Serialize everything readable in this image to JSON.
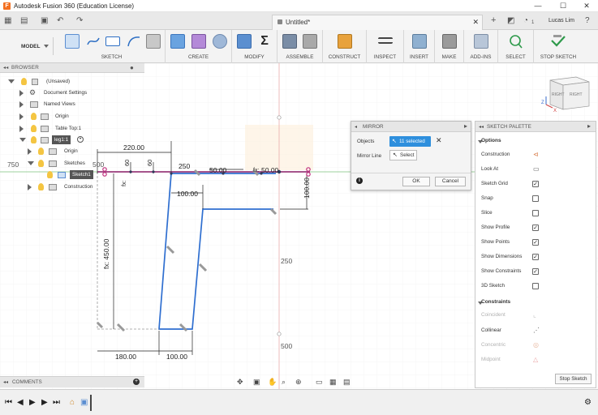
{
  "window": {
    "app_icon_letter": "F",
    "title": "Autodesk Fusion 360 (Education License)",
    "minimize": "—",
    "maximize": "☐",
    "close": "✕"
  },
  "tabbar": {
    "document_name": "Untitled*",
    "close_tab": "✕",
    "new_tab": "+",
    "user_name": "Lucas Lim",
    "notification_count": "1"
  },
  "ribbon": {
    "workspace": "MODEL",
    "groups": [
      "SKETCH",
      "CREATE",
      "MODIFY",
      "ASSEMBLE",
      "CONSTRUCT",
      "INSPECT",
      "INSERT",
      "MAKE",
      "ADD-INS",
      "SELECT",
      "STOP SKETCH"
    ]
  },
  "browser": {
    "title": "BROWSER",
    "items": [
      {
        "label": "(Unsaved)"
      },
      {
        "label": "Document Settings"
      },
      {
        "label": "Named Views"
      },
      {
        "label": "Origin"
      },
      {
        "label": "Table Top:1"
      },
      {
        "label": "leg1:1"
      },
      {
        "label": "Origin"
      },
      {
        "label": "Sketches"
      },
      {
        "label": "Sketch1"
      },
      {
        "label": "Construction"
      }
    ]
  },
  "comments": {
    "title": "COMMENTS"
  },
  "mirror": {
    "title": "MIRROR",
    "objects_label": "Objects",
    "objects_value": "11 selected",
    "mirror_line_label": "Mirror Line",
    "mirror_line_value": "Select",
    "ok": "OK",
    "cancel": "Cancel",
    "info_icon": "i"
  },
  "palette": {
    "title": "SKETCH PALETTE",
    "options_header": "Options",
    "options": [
      {
        "label": "Construction",
        "kind": "icon",
        "checked": false,
        "disabled": false
      },
      {
        "label": "Look At",
        "kind": "icon",
        "checked": false,
        "disabled": false
      },
      {
        "label": "Sketch Grid",
        "kind": "check",
        "checked": true,
        "disabled": false
      },
      {
        "label": "Snap",
        "kind": "check",
        "checked": false,
        "disabled": false
      },
      {
        "label": "Slice",
        "kind": "check",
        "checked": false,
        "disabled": false
      },
      {
        "label": "Show Profile",
        "kind": "check",
        "checked": true,
        "disabled": false
      },
      {
        "label": "Show Points",
        "kind": "check",
        "checked": true,
        "disabled": false
      },
      {
        "label": "Show Dimensions",
        "kind": "check",
        "checked": true,
        "disabled": false
      },
      {
        "label": "Show Constraints",
        "kind": "check",
        "checked": true,
        "disabled": false
      },
      {
        "label": "3D Sketch",
        "kind": "check",
        "checked": false,
        "disabled": false
      }
    ],
    "constraints_header": "Constraints",
    "constraints": [
      {
        "label": "Coincident",
        "disabled": true
      },
      {
        "label": "Collinear",
        "disabled": false
      },
      {
        "label": "Concentric",
        "disabled": true
      },
      {
        "label": "Midpoint",
        "disabled": true
      }
    ],
    "stop_sketch": "Stop Sketch"
  },
  "viewcube": {
    "left_face": "RIGHT",
    "right_face": "RIGHT",
    "axis_x": "X",
    "axis_z": "Z"
  },
  "canvas": {
    "axis_labels": [
      "750",
      "500",
      "250",
      "250",
      "500"
    ],
    "dimensions": [
      "220.00",
      "60",
      "60",
      "250",
      "50.00",
      "50.00",
      "100.00",
      "100.00",
      "fx: 450.00",
      "180.00",
      "100.00",
      "fx:",
      "fx:"
    ]
  }
}
